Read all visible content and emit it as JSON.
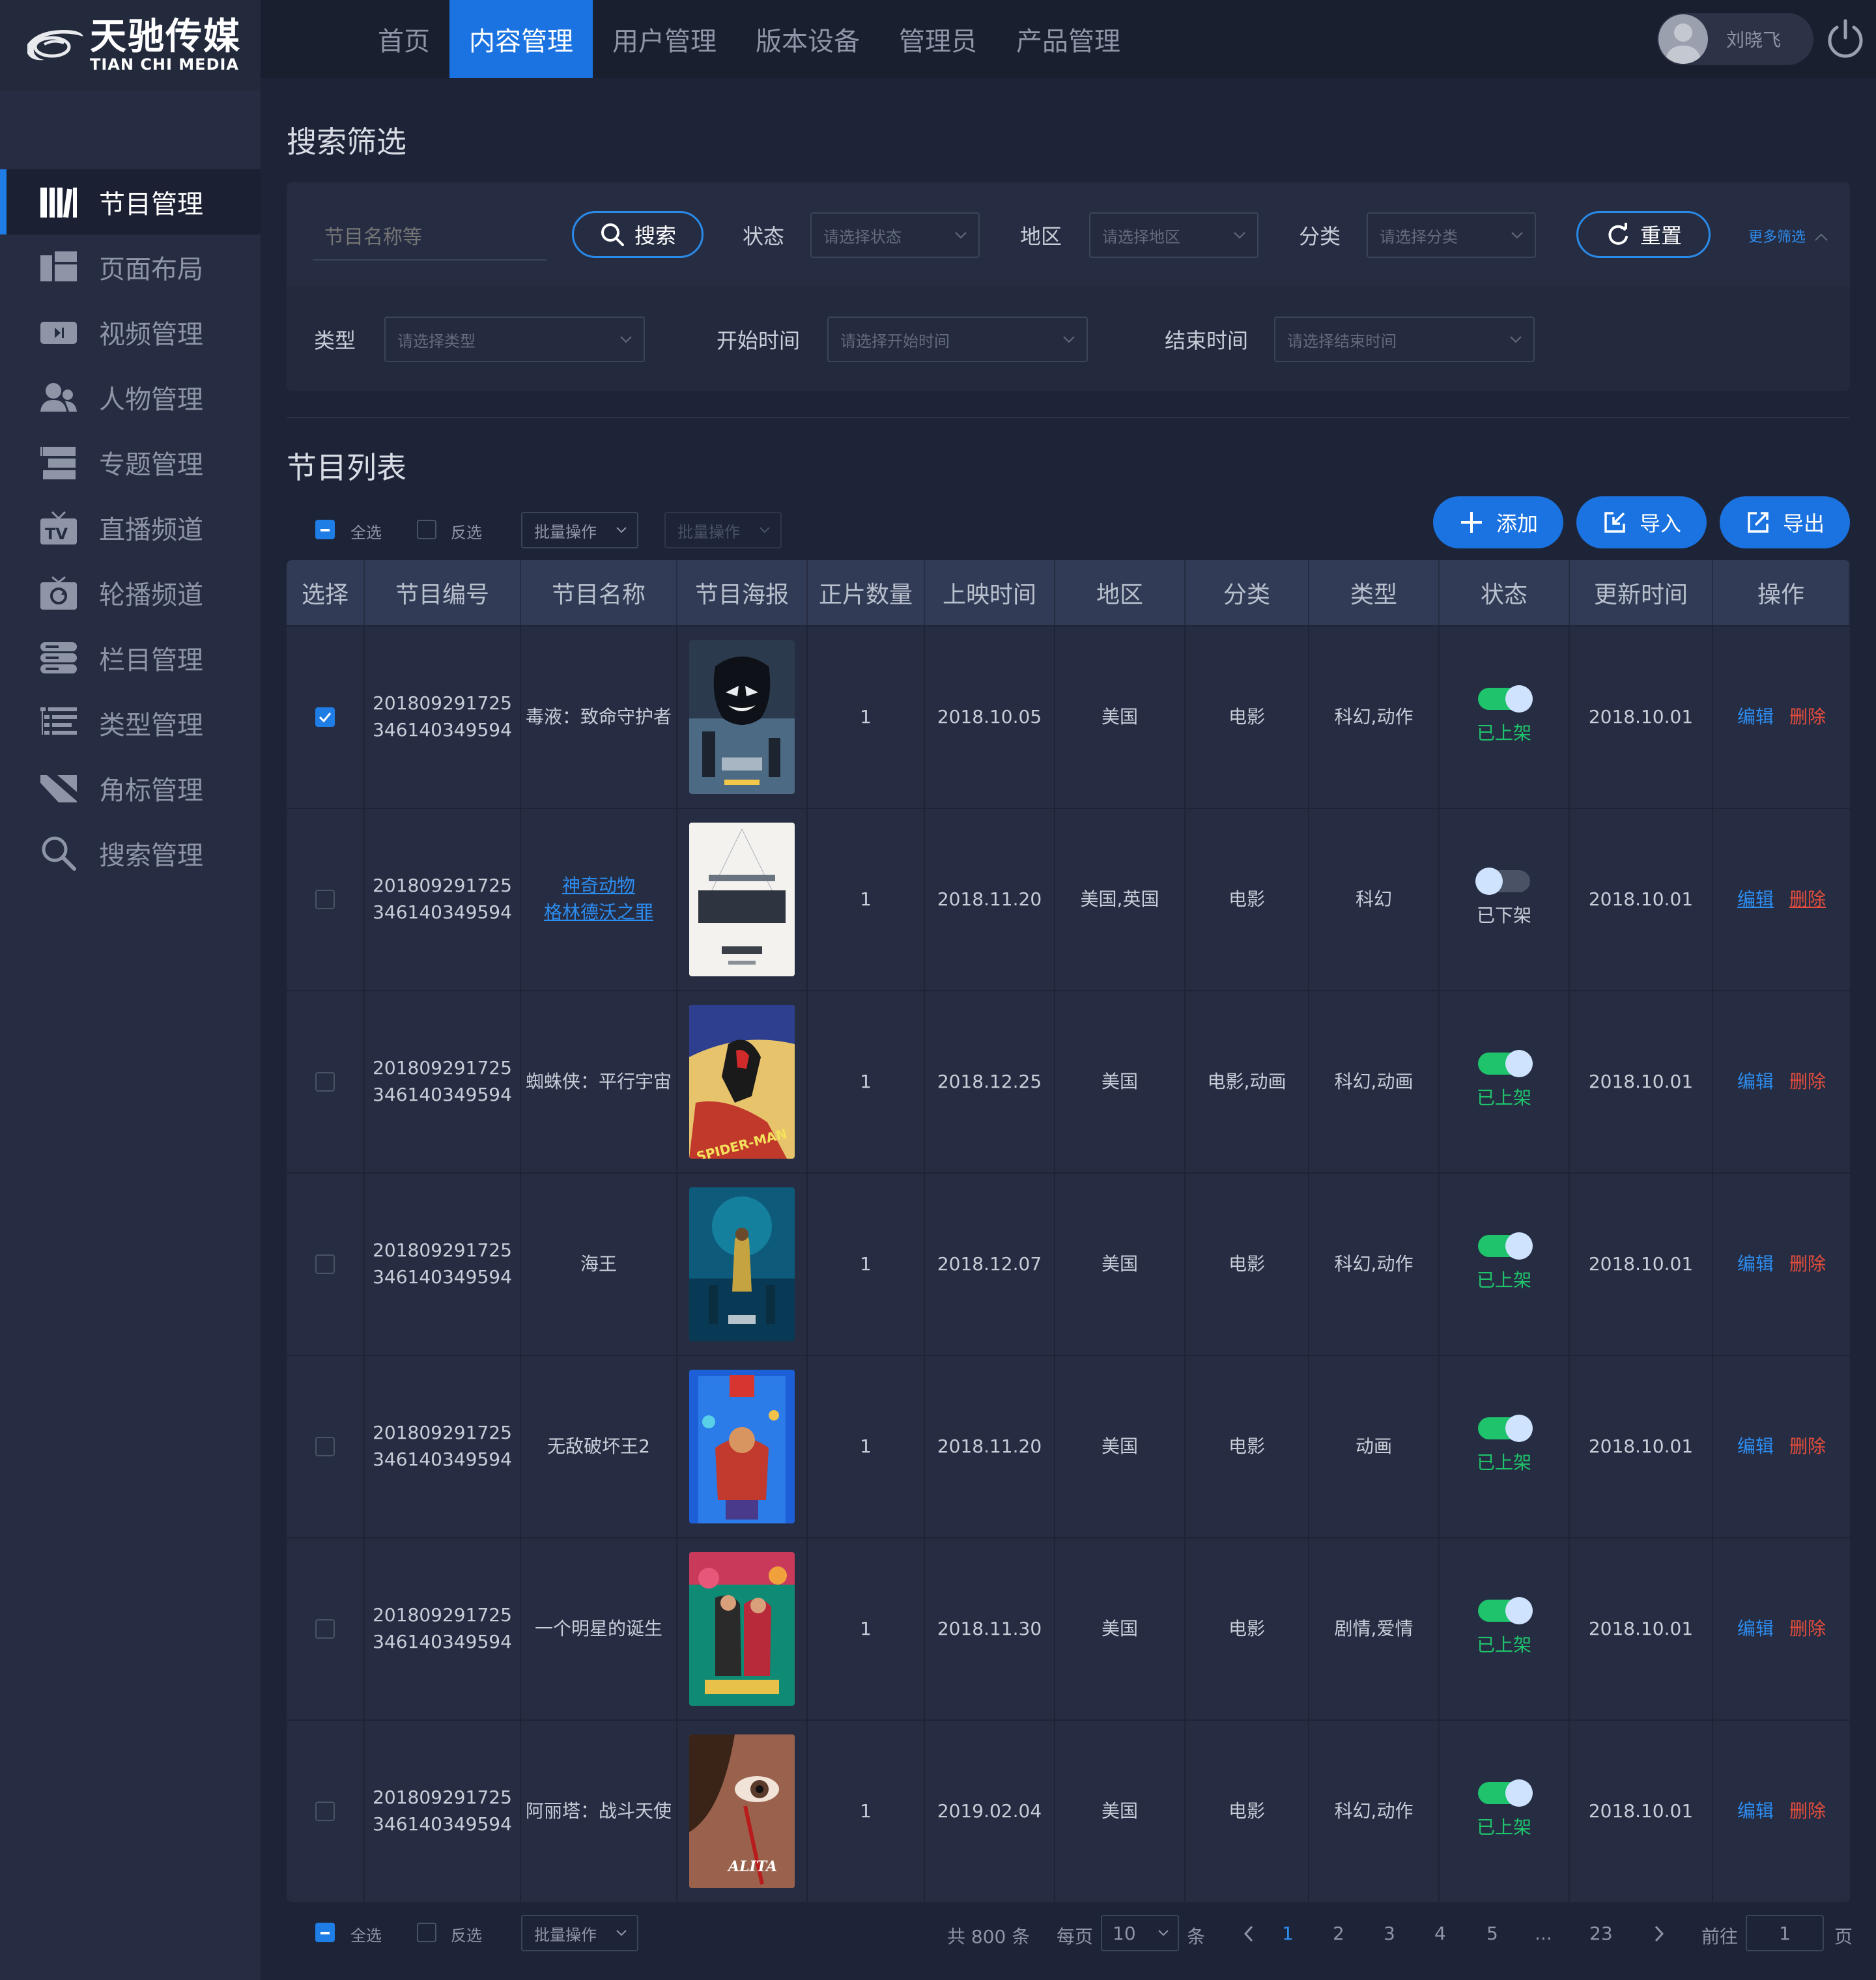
{
  "brand": {
    "name_cn": "天驰传媒",
    "name_en": "TIAN CHI MEDIA"
  },
  "top_nav": [
    {
      "label": "首页",
      "active": false
    },
    {
      "label": "内容管理",
      "active": true
    },
    {
      "label": "用户管理",
      "active": false
    },
    {
      "label": "版本设备",
      "active": false
    },
    {
      "label": "管理员",
      "active": false
    },
    {
      "label": "产品管理",
      "active": false
    }
  ],
  "user": {
    "name": "刘晓飞"
  },
  "sidebar": [
    {
      "label": "节目管理",
      "icon": "program-icon",
      "active": true
    },
    {
      "label": "页面布局",
      "icon": "layout-icon",
      "active": false
    },
    {
      "label": "视频管理",
      "icon": "video-icon",
      "active": false
    },
    {
      "label": "人物管理",
      "icon": "people-icon",
      "active": false
    },
    {
      "label": "专题管理",
      "icon": "topic-icon",
      "active": false
    },
    {
      "label": "直播频道",
      "icon": "tv-icon",
      "active": false
    },
    {
      "label": "轮播频道",
      "icon": "carousel-icon",
      "active": false
    },
    {
      "label": "栏目管理",
      "icon": "column-icon",
      "active": false
    },
    {
      "label": "类型管理",
      "icon": "type-icon",
      "active": false
    },
    {
      "label": "角标管理",
      "icon": "badge-icon",
      "active": false
    },
    {
      "label": "搜索管理",
      "icon": "search-icon",
      "active": false
    }
  ],
  "filter": {
    "title": "搜索筛选",
    "keyword_placeholder": "节目名称等",
    "search_label": "搜索",
    "status_label": "状态",
    "status_placeholder": "请选择状态",
    "region_label": "地区",
    "region_placeholder": "请选择地区",
    "category_label": "分类",
    "category_placeholder": "请选择分类",
    "reset_label": "重置",
    "more_label": "更多筛选",
    "type_label": "类型",
    "type_placeholder": "请选择类型",
    "start_label": "开始时间",
    "start_placeholder": "请选择开始时间",
    "end_label": "结束时间",
    "end_placeholder": "请选择结束时间"
  },
  "list": {
    "title": "节目列表",
    "select_all": "全选",
    "invert": "反选",
    "bulk_label": "批量操作",
    "add_label": "添加",
    "import_label": "导入",
    "export_label": "导出"
  },
  "table": {
    "headers": [
      "选择",
      "节目编号",
      "节目名称",
      "节目海报",
      "正片数量",
      "上映时间",
      "地区",
      "分类",
      "类型",
      "状态",
      "更新时间",
      "操作"
    ],
    "edit_label": "编辑",
    "delete_label": "删除",
    "rows": [
      {
        "checked": true,
        "id_line1": "201809291725",
        "id_line2": "346140349594",
        "name": "毒液：致命守护者",
        "link": false,
        "poster": "poster-venom",
        "count": "1",
        "release": "2018.10.05",
        "region": "美国",
        "category": "电影",
        "type": "科幻,动作",
        "on": true,
        "status": "已上架",
        "updated": "2018.10.01"
      },
      {
        "checked": false,
        "id_line1": "201809291725",
        "id_line2": "346140349594",
        "name_line1": "神奇动物",
        "name_line2": "格林德沃之罪",
        "link": true,
        "poster": "poster-fantastic-beasts",
        "count": "1",
        "release": "2018.11.20",
        "region": "美国,英国",
        "category": "电影",
        "type": "科幻",
        "on": false,
        "status": "已下架",
        "updated": "2018.10.01"
      },
      {
        "checked": false,
        "id_line1": "201809291725",
        "id_line2": "346140349594",
        "name": "蜘蛛侠：平行宇宙",
        "link": false,
        "poster": "poster-spider-verse",
        "count": "1",
        "release": "2018.12.25",
        "region": "美国",
        "category": "电影,动画",
        "type": "科幻,动画",
        "on": true,
        "status": "已上架",
        "updated": "2018.10.01"
      },
      {
        "checked": false,
        "id_line1": "201809291725",
        "id_line2": "346140349594",
        "name": "海王",
        "link": false,
        "poster": "poster-aquaman",
        "count": "1",
        "release": "2018.12.07",
        "region": "美国",
        "category": "电影",
        "type": "科幻,动作",
        "on": true,
        "status": "已上架",
        "updated": "2018.10.01"
      },
      {
        "checked": false,
        "id_line1": "201809291725",
        "id_line2": "346140349594",
        "name": "无敌破坏王2",
        "link": false,
        "poster": "poster-ralph",
        "count": "1",
        "release": "2018.11.20",
        "region": "美国",
        "category": "电影",
        "type": "动画",
        "on": true,
        "status": "已上架",
        "updated": "2018.10.01"
      },
      {
        "checked": false,
        "id_line1": "201809291725",
        "id_line2": "346140349594",
        "name": "一个明星的诞生",
        "link": false,
        "poster": "poster-crazy-rich",
        "count": "1",
        "release": "2018.11.30",
        "region": "美国",
        "category": "电影",
        "type": "剧情,爱情",
        "on": true,
        "status": "已上架",
        "updated": "2018.10.01"
      },
      {
        "checked": false,
        "id_line1": "201809291725",
        "id_line2": "346140349594",
        "name": "阿丽塔：战斗天使",
        "link": false,
        "poster": "poster-alita",
        "count": "1",
        "release": "2019.02.04",
        "region": "美国",
        "category": "电影",
        "type": "科幻,动作",
        "on": true,
        "status": "已上架",
        "updated": "2018.10.01"
      }
    ]
  },
  "pagination": {
    "total": "共 800 条",
    "per_page_label": "每页",
    "per_page_value": "10",
    "per_page_unit": "条",
    "pages": [
      "1",
      "2",
      "3",
      "4",
      "5",
      "...",
      "23"
    ],
    "current": "1",
    "goto_label": "前往",
    "goto_value": "1",
    "goto_unit": "页"
  },
  "colors": {
    "accent": "#1a73e0",
    "on": "#1fc36b",
    "danger": "#e34d3d"
  }
}
